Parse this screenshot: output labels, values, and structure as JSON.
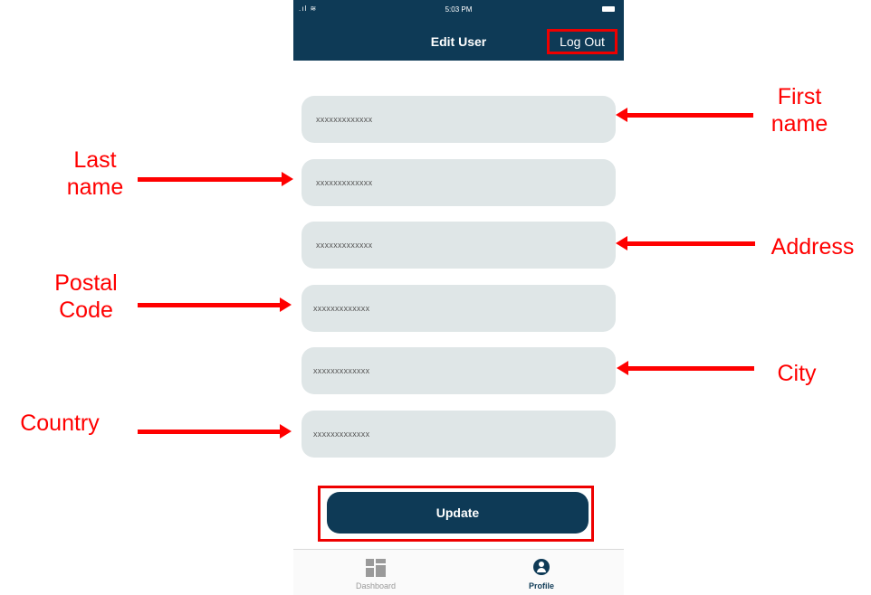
{
  "status_bar": {
    "time": "5:03 PM"
  },
  "header": {
    "title": "Edit User",
    "logout_label": "Log Out"
  },
  "fields": [
    {
      "value": "xxxxxxxxxxxxx"
    },
    {
      "value": "xxxxxxxxxxxxx"
    },
    {
      "value": "xxxxxxxxxxxxx"
    },
    {
      "value": "xxxxxxxxxxxxx"
    },
    {
      "value": "xxxxxxxxxxxxx"
    },
    {
      "value": "xxxxxxxxxxxxx"
    }
  ],
  "update_label": "Update",
  "tabs": [
    {
      "label": "Dashboard",
      "icon": "dashboard-icon"
    },
    {
      "label": "Profile",
      "icon": "profile-icon"
    }
  ],
  "annotations": {
    "first_name": "First\nname",
    "last_name": "Last\nname",
    "address": "Address",
    "postal_code": "Postal\nCode",
    "city": "City",
    "country": "Country"
  },
  "colors": {
    "brand": "#0e3a56",
    "field_bg": "#dfe6e7",
    "annotation": "#ff0000"
  }
}
